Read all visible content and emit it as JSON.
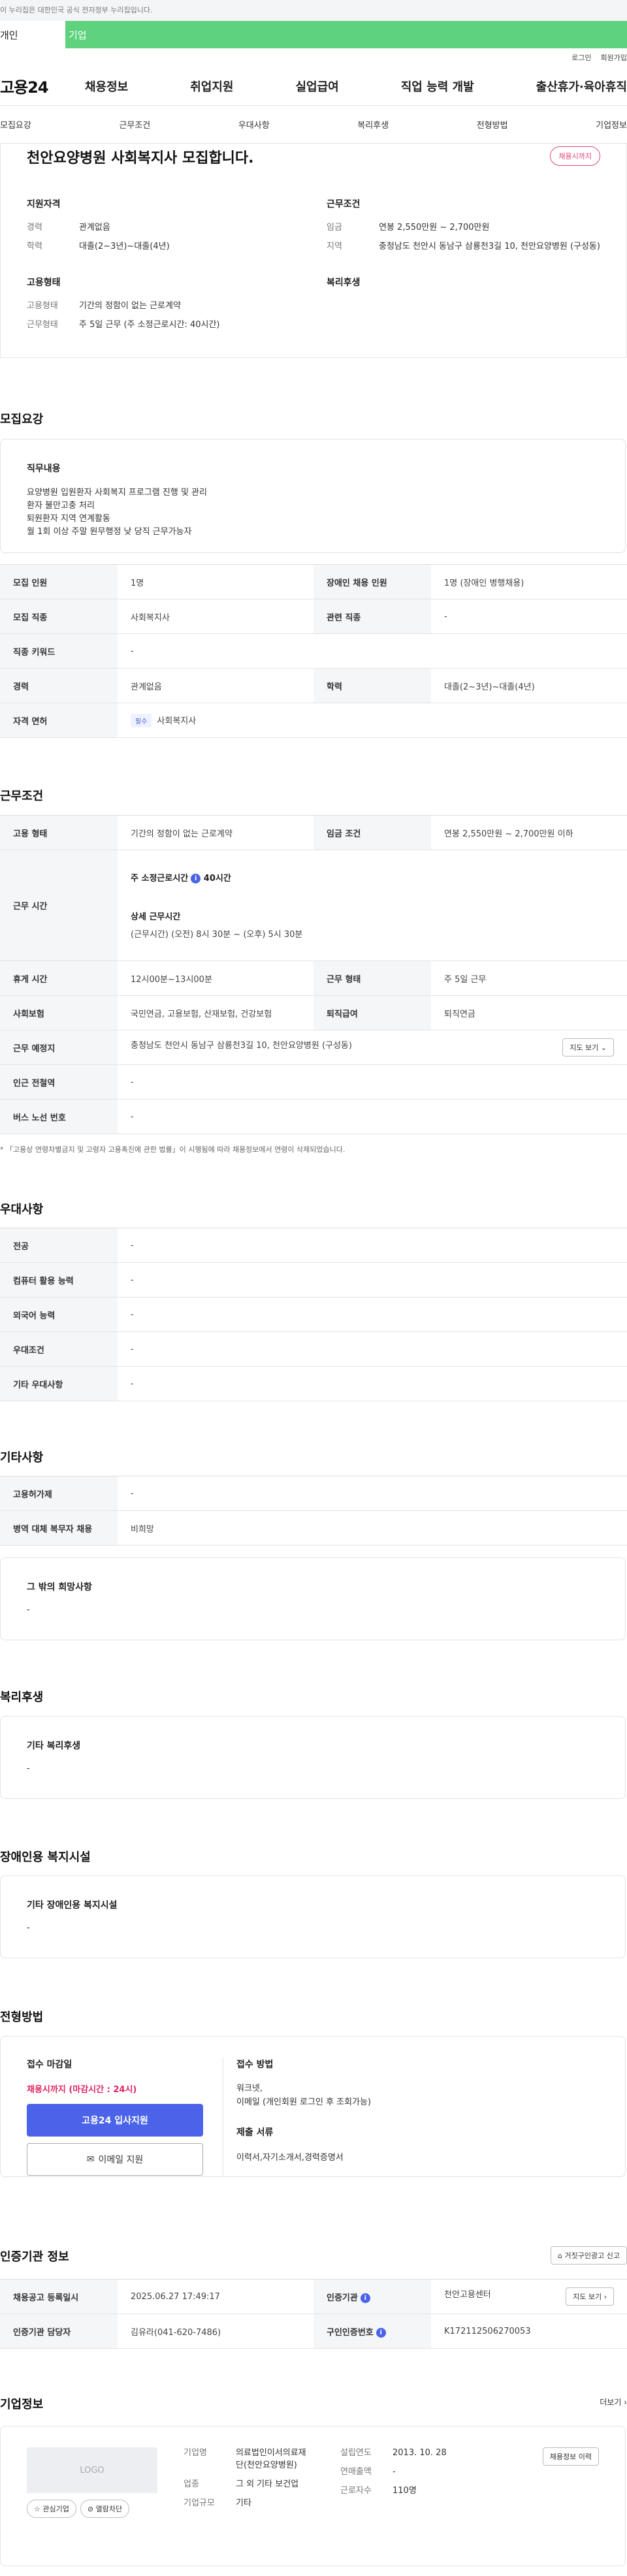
{
  "topbar": {
    "notice": "이 누리집은 대한민국 공식 전자정부 누리집입니다."
  },
  "global_tabs": {
    "personal": "개인",
    "corporate": "기업"
  },
  "utility": {
    "login": "로그인",
    "signup": "회원가입"
  },
  "gnb": {
    "logo": "고용24",
    "menu": [
      "채용정보",
      "취업지원",
      "실업급여",
      "직업 능력 개발",
      "출산휴가·육아휴직"
    ]
  },
  "subnav": [
    "모집요강",
    "근무조건",
    "우대사항",
    "복리후생",
    "전형방법",
    "기업정보"
  ],
  "summary": {
    "title": "천안요양병원 사회복지사 모집합니다.",
    "badge": "채용시까지",
    "qualification": {
      "heading": "지원자격",
      "rows": [
        {
          "k": "경력",
          "v": "관계없음"
        },
        {
          "k": "학력",
          "v": "대졸(2~3년)~대졸(4년)"
        }
      ]
    },
    "conditions": {
      "heading": "근무조건",
      "rows": [
        {
          "k": "임금",
          "v": "연봉 2,550만원 ~ 2,700만원"
        },
        {
          "k": "지역",
          "v": "충청남도 천안시 동남구 삼룡천3길 10, 천안요양병원 (구성동)"
        }
      ]
    },
    "employment": {
      "heading": "고용형태",
      "rows": [
        {
          "k": "고용형태",
          "v": "기간의 정함이 없는 근로계약"
        },
        {
          "k": "근무형태",
          "v": "주 5일 근무 (주 소정근로시간: 40시간)"
        }
      ]
    },
    "welfare": {
      "heading": "복리후생"
    }
  },
  "recruit": {
    "heading": "모집요강",
    "duty_title": "직무내용",
    "duty_lines": [
      "요양병원 입원환자 사회복지 프로그램 진행 및 관리",
      "환자 불만고충 처리",
      "퇴원환자 지역 연계활동",
      "월 1회 이상 주말 원무행정 낮 당직 근무가능자"
    ],
    "rows": [
      {
        "k1": "모집 인원",
        "v1": "1명",
        "k2": "장애인 채용 인원",
        "v2": "1명 (장애인 병행채용)"
      },
      {
        "k1": "모집 직종",
        "v1": "사회복지사",
        "k2": "관련 직종",
        "v2": "-"
      },
      {
        "k1": "직종 키워드",
        "v1": "-"
      },
      {
        "k1": "경력",
        "v1": "관계없음",
        "k2": "학력",
        "v2": "대졸(2~3년)~대졸(4년)"
      }
    ],
    "license_label": "자격 면허",
    "license_tag": "필수",
    "license_value": "사회복지사"
  },
  "work": {
    "heading": "근무조건",
    "employ_type_k": "고용 형태",
    "employ_type_v": "기간의 정함이 없는 근로계약",
    "wage_k": "임금 조건",
    "wage_v": "연봉 2,550만원 ~ 2,700만원 이하",
    "hours_k": "근무 시간",
    "weekly_label": "주 소정근로시간",
    "weekly_value": "40시간",
    "detail_label": "상세 근무시간",
    "detail_value": "(근무시간) (오전) 8시 30분 ~ (오후) 5시 30분",
    "rest_k": "휴게 시간",
    "rest_v": "12시00분~13시00분",
    "form_k": "근무 형태",
    "form_v": "주 5일 근무",
    "insurance_k": "사회보험",
    "insurance_v": "국민연금, 고용보험, 산재보험, 건강보험",
    "severance_k": "퇴직급여",
    "severance_v": "퇴직연금",
    "location_k": "근무 예정지",
    "location_v": "충청남도 천안시 동남구 삼룡천3길 10, 천안요양병원 (구성동)",
    "map_btn": "지도 보기",
    "station_k": "인근 전철역",
    "station_v": "-",
    "bus_k": "버스 노선 번호",
    "bus_v": "-",
    "note": "* 「고용상 연령차별금지 및 고령자 고용촉진에 관한 법률」이 시행됨에 따라 채용정보에서 연령이 삭제되었습니다."
  },
  "pref": {
    "heading": "우대사항",
    "rows": [
      {
        "k": "전공",
        "v": "-"
      },
      {
        "k": "컴퓨터 활용 능력",
        "v": "-"
      },
      {
        "k": "외국어 능력",
        "v": "-"
      },
      {
        "k": "우대조건",
        "v": "-"
      },
      {
        "k": "기타 우대사항",
        "v": "-"
      }
    ]
  },
  "etc": {
    "heading": "기타사항",
    "rows": [
      {
        "k": "고용허가제",
        "v": "-"
      },
      {
        "k": "병역 대체 복무자 채용",
        "v": "비희망"
      }
    ],
    "hope_title": "그 밖의 희망사항",
    "hope_value": "-"
  },
  "welfare": {
    "heading": "복리후생",
    "title": "기타 복리후생",
    "value": "-"
  },
  "disability": {
    "heading": "장애인용 복지시설",
    "title": "기타 장애인용 복지시설",
    "value": "-"
  },
  "selection": {
    "heading": "전형방법",
    "deadline_title": "접수 마감일",
    "deadline_value": "채용시까지 (마감시간 : 24시)",
    "apply_btn": "고용24 입사지원",
    "email_btn": "이메일 지원",
    "method_title": "접수 방법",
    "method_lines": [
      "워크넷,",
      "이메일 (개인회원 로그인 후 조회가능)"
    ],
    "docs_title": "제출 서류",
    "docs_value": "이력서,자기소개서,경력증명서"
  },
  "agency": {
    "heading": "인증기관 정보",
    "report_btn": "거짓구인광고 신고",
    "reg_k": "채용공고 등록일시",
    "reg_v": "2025.06.27 17:49:17",
    "agency_k": "인증기관",
    "agency_v": "천안고용센터",
    "map_btn": "지도 보기",
    "manager_k": "인증기관 담당자",
    "manager_v": "김유라(041-620-7486)",
    "num_k": "구인인증번호",
    "num_v": "K172112506270053"
  },
  "company": {
    "heading": "기업정보",
    "more": "더보기",
    "logo_text": "LOGO",
    "fav_btn": "관심기업",
    "block_btn": "열람차단",
    "name_k": "기업명",
    "name_v": "의료법인이서의료재단(천안요양병원)",
    "industry_k": "업종",
    "industry_v": "그 외 기타 보건업",
    "size_k": "기업규모",
    "size_v": "기타",
    "founded_k": "설립연도",
    "founded_v": "2013. 10. 28",
    "sales_k": "연매출액",
    "sales_v": "-",
    "employees_k": "근로자수",
    "employees_v": "110명",
    "history_btn": "채용정보 이력"
  }
}
